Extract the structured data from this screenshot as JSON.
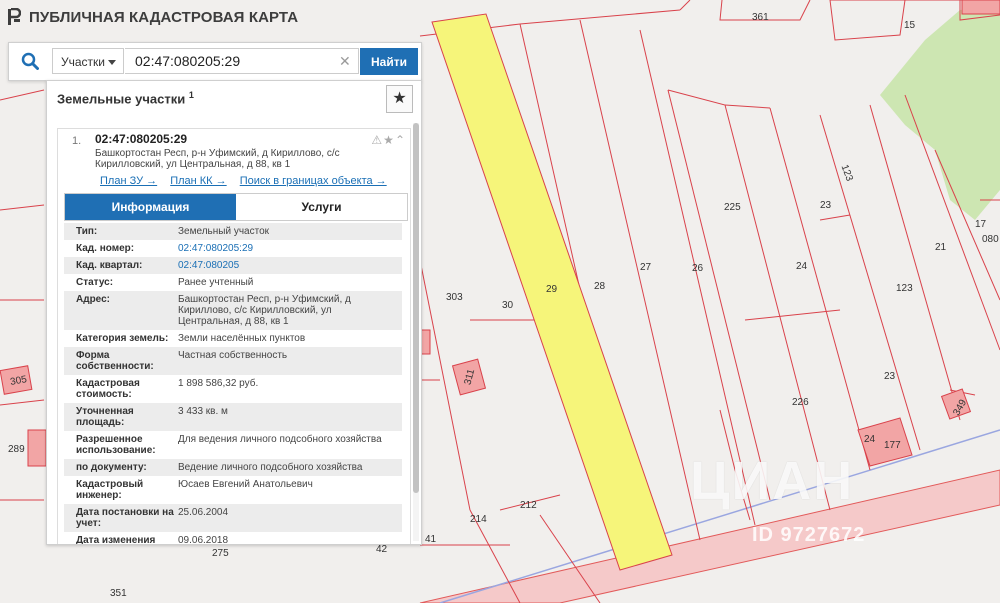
{
  "header": {
    "title": "ПУБЛИЧНАЯ КАДАСТРОВАЯ КАРТА"
  },
  "search": {
    "type_label": "Участки",
    "query": "02:47:080205:29",
    "find_label": "Найти"
  },
  "panel": {
    "title": "Земельные участки",
    "title_count": "1",
    "result": {
      "number": "1.",
      "cad_number": "02:47:080205:29",
      "address": "Башкортостан Респ, р-н Уфимский, д Кириллово, с/с Кирилловский, ул Центральная, д 88, кв 1",
      "links": [
        "План ЗУ →",
        "План КК →",
        "Поиск в границах объекта →"
      ],
      "tabs": {
        "info": "Информация",
        "services": "Услуги"
      },
      "properties": [
        {
          "label": "Тип:",
          "value": "Земельный участок"
        },
        {
          "label": "Кад. номер:",
          "value": "02:47:080205:29"
        },
        {
          "label": "Кад. квартал:",
          "value": "02:47:080205"
        },
        {
          "label": "Статус:",
          "value": "Ранее учтенный"
        },
        {
          "label": "Адрес:",
          "value": "Башкортостан Респ, р-н Уфимский, д Кириллово, с/с Кирилловский, ул Центральная, д 88, кв 1"
        },
        {
          "label": "Категория земель:",
          "value": "Земли населённых пунктов"
        },
        {
          "label": "Форма собственности:",
          "value": "Частная собственность"
        },
        {
          "label": "Кадастровая стоимость:",
          "value": "1 898 586,32 руб."
        },
        {
          "label": "Уточненная площадь:",
          "value": "3 433 кв. м"
        },
        {
          "label": "Разрешенное использование:",
          "value": "Для ведения личного подсобного хозяйства"
        },
        {
          "label": "по документу:",
          "value": "Ведение личного подсобного хозяйства"
        },
        {
          "label": "Кадастровый инженер:",
          "value": "Юсаев Евгений Анатольевич"
        },
        {
          "label": "Дата постановки на учет:",
          "value": "25.06.2004"
        },
        {
          "label": "Дата изменения",
          "value": "09.06.2018"
        }
      ]
    }
  },
  "map": {
    "labels": [
      "361",
      "15",
      "17",
      "080",
      "21",
      "123",
      "123",
      "23",
      "23",
      "24",
      "225",
      "226",
      "27",
      "26",
      "28",
      "29",
      "30",
      "303",
      "212",
      "214",
      "42",
      "41",
      "275",
      "351",
      "289",
      "305",
      "24",
      "177",
      "349",
      "311"
    ]
  },
  "watermark": {
    "logo": "ЦИАН",
    "id": "ID 9727672"
  }
}
